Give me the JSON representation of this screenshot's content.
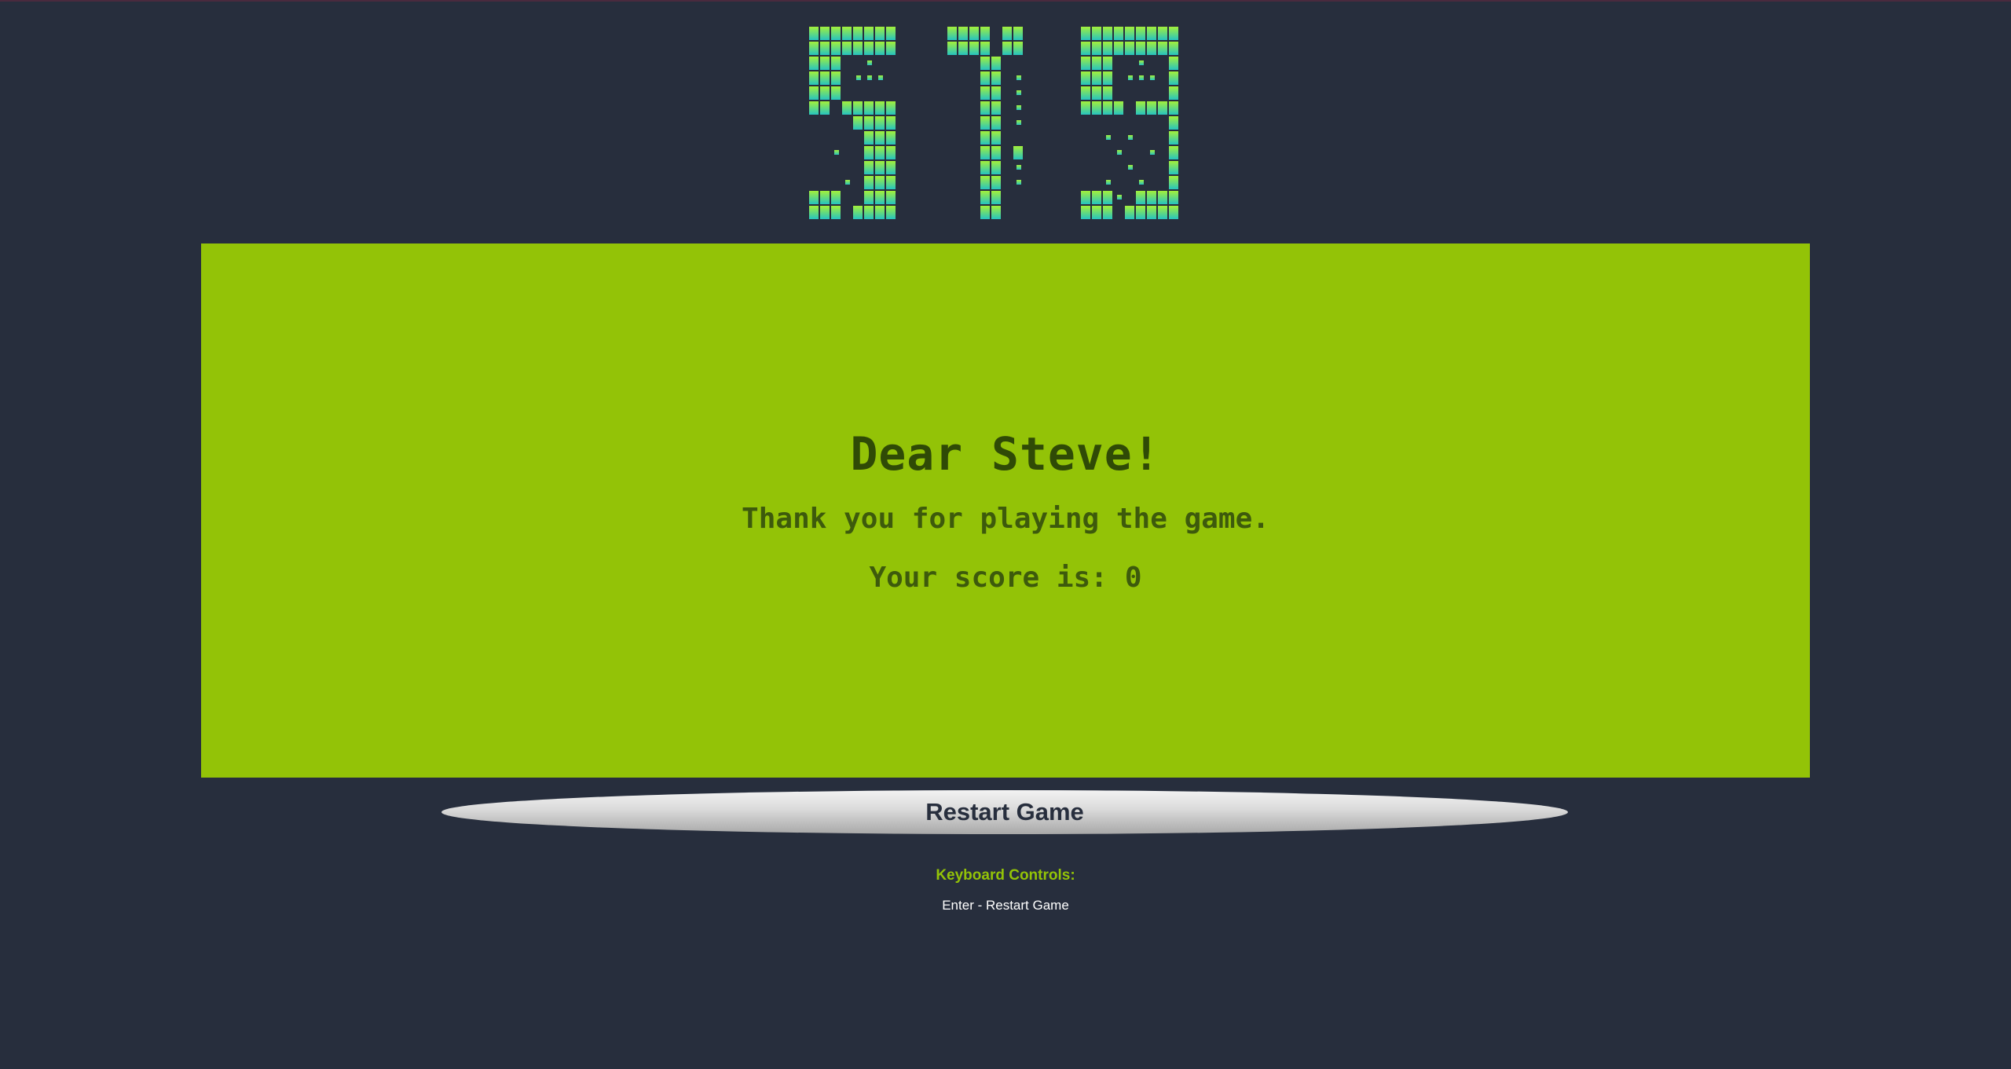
{
  "logo": {
    "name": "STG",
    "gradient_top": "#a3f03a",
    "gradient_bottom": "#26c4c0"
  },
  "end_screen": {
    "greeting": "Dear Steve!",
    "thanks": "Thank you for playing the game.",
    "score_label": "Your score is:",
    "score_value": "0",
    "panel_color": "#93c307",
    "text_color": "#3d5a0c"
  },
  "restart_button": {
    "label": "Restart Game"
  },
  "keyboard_controls": {
    "title": "Keyboard Controls:",
    "items": [
      "Enter - Restart Game"
    ]
  },
  "colors": {
    "background": "#272e3d",
    "accent": "#93c307"
  }
}
